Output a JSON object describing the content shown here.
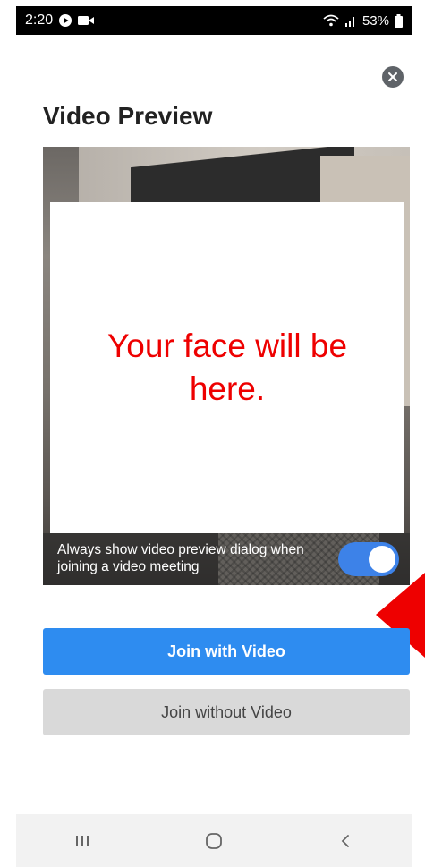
{
  "status_bar": {
    "time": "2:20",
    "battery": "53%"
  },
  "dialog": {
    "title": "Video Preview",
    "face_placeholder": "Your face will be here.",
    "toggle_label": "Always show video preview dialog when joining a video meeting",
    "toggle_on": true
  },
  "buttons": {
    "join_with_video": "Join with Video",
    "join_without_video": "Join without Video"
  },
  "icons": {
    "status": [
      "play-icon",
      "video-camera-icon",
      "wifi-icon",
      "signal-icon",
      "battery-icon"
    ],
    "nav": [
      "recent-apps-icon",
      "home-icon",
      "back-icon"
    ]
  },
  "colors": {
    "primary": "#2e8cf0",
    "toggle": "#3d82e8",
    "annotation": "#ee0000"
  }
}
